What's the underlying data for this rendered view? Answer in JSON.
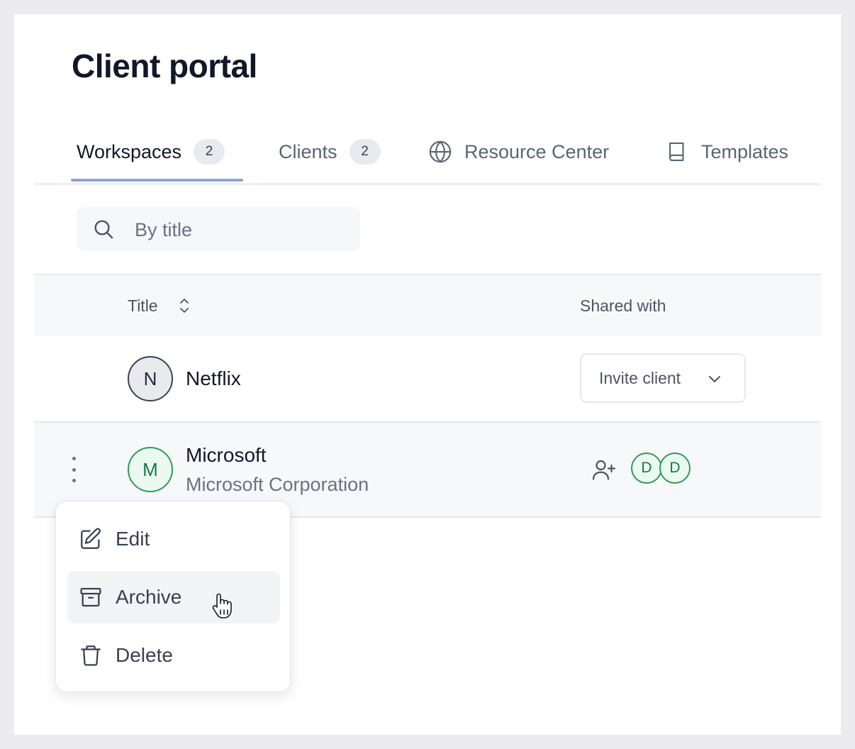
{
  "page": {
    "title": "Client portal"
  },
  "tabs": [
    {
      "label": "Workspaces",
      "count": "2",
      "active": true
    },
    {
      "label": "Clients",
      "count": "2"
    },
    {
      "label": "Resource Center",
      "icon": "globe-icon"
    },
    {
      "label": "Templates",
      "icon": "book-icon"
    }
  ],
  "search": {
    "placeholder": "By title",
    "value": ""
  },
  "table": {
    "columns": {
      "title": "Title",
      "shared_with": "Shared with"
    },
    "rows": [
      {
        "initial": "N",
        "name": "Netflix",
        "invite_label": "Invite client"
      },
      {
        "initial": "M",
        "name": "Microsoft",
        "subtitle": "Microsoft Corporation",
        "shared": [
          "D",
          "D"
        ]
      }
    ]
  },
  "menu": {
    "items": [
      {
        "label": "Edit",
        "icon": "edit-icon"
      },
      {
        "label": "Archive",
        "icon": "archive-icon",
        "hovered": true
      },
      {
        "label": "Delete",
        "icon": "trash-icon"
      }
    ]
  },
  "colors": {
    "accent_underline": "#8ea4d2",
    "success_green": "#2e9b5a",
    "text_primary": "#111827",
    "text_muted": "#6b7280"
  }
}
